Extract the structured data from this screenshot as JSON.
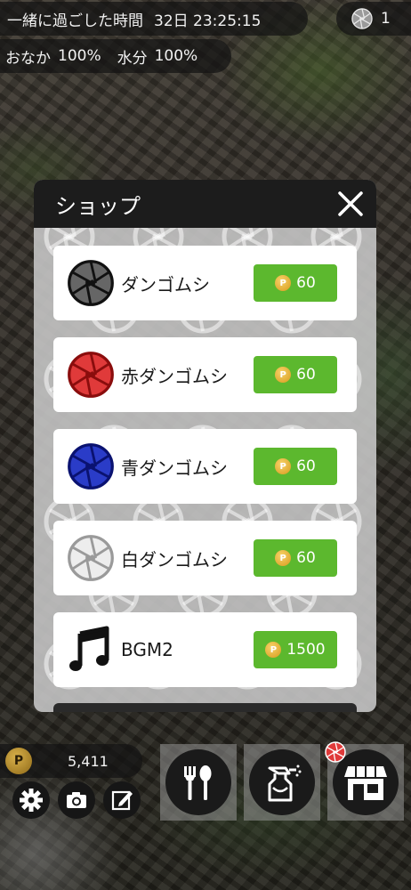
{
  "status": {
    "time_label": "一緒に過ごした時間",
    "time_value": "32日 23:25:15",
    "coin_count": "1",
    "hunger_label": "おなか",
    "hunger_value": "100%",
    "water_label": "水分",
    "water_value": "100%"
  },
  "shop": {
    "title": "ショップ",
    "items": [
      {
        "name": "ダンゴムシ",
        "price": "60",
        "icon": "pillbug-gray-icon",
        "color": "#666666"
      },
      {
        "name": "赤ダンゴムシ",
        "price": "60",
        "icon": "pillbug-red-icon",
        "color": "#e03a3a"
      },
      {
        "name": "青ダンゴムシ",
        "price": "60",
        "icon": "pillbug-blue-icon",
        "color": "#2a3cc8"
      },
      {
        "name": "白ダンゴムシ",
        "price": "60",
        "icon": "pillbug-white-icon",
        "color": "#c8c8c8"
      },
      {
        "name": "BGM2",
        "price": "1500",
        "icon": "music-note-icon",
        "color": "#111111"
      }
    ],
    "coin_symbol": "P"
  },
  "bottom": {
    "points_symbol": "P",
    "points_value": "5,411",
    "buttons": [
      "settings-icon",
      "camera-icon",
      "edit-icon",
      "food-icon",
      "spray-icon",
      "shop-icon"
    ]
  }
}
